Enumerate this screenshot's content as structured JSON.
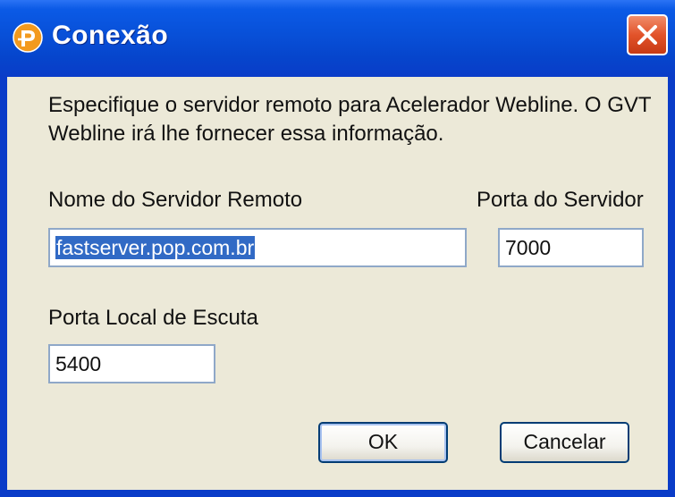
{
  "window": {
    "title": "Conexão",
    "icon": "app-logo-icon",
    "close_icon": "close-icon"
  },
  "description": "Especifique o servidor remoto para Acelerador Webline. O GVT Webline irá lhe fornecer essa informação.",
  "fields": {
    "server_name": {
      "label": "Nome do Servidor Remoto",
      "value": "fastserver.pop.com.br"
    },
    "server_port": {
      "label": "Porta do Servidor",
      "value": "7000"
    },
    "local_port": {
      "label": "Porta Local de Escuta",
      "value": "5400"
    }
  },
  "buttons": {
    "ok": "OK",
    "cancel": "Cancelar"
  },
  "colors": {
    "titlebar": "#0850d8",
    "close_button": "#e2532a",
    "dialog_background": "#ece9d8",
    "selection": "#316ac5"
  }
}
